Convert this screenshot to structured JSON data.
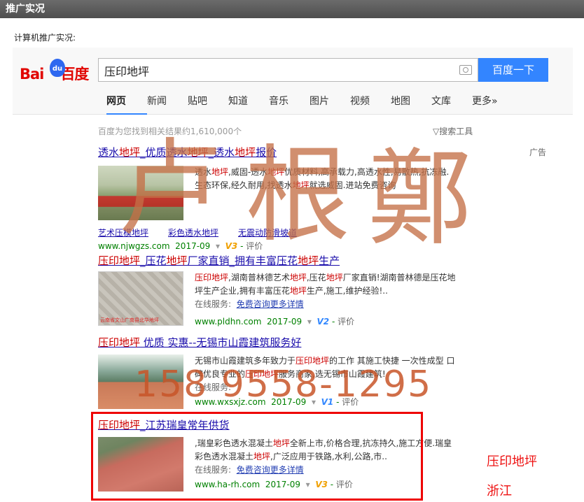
{
  "window": {
    "title": "推广实况",
    "subtitle": "计算机推广实况:"
  },
  "baidu": {
    "logo_text": "Bai",
    "logo_paw": "du",
    "logo_tail": "百度",
    "query": "压印地坪",
    "search_button": "百度一下",
    "tabs": [
      "网页",
      "新闻",
      "贴吧",
      "知道",
      "音乐",
      "图片",
      "视频",
      "地图",
      "文库",
      "更多»"
    ],
    "result_count": "百度为您找到相关结果约1,610,000个",
    "tools": "搜索工具",
    "ad_label": "广告"
  },
  "results": [
    {
      "title_parts": [
        "透水",
        "地坪",
        "_优质透水",
        "地坪",
        "_透水",
        "地坪",
        "报价"
      ],
      "desc_lines": [
        "透水地坪,威固-透水地坪优质材料,高承载力,高透水性,易散热,抗冻融.",
        "生态环保,经久耐用,找透水地坪就选威固.进站免费咨询"
      ],
      "sublinks": [
        "艺术压模地坪",
        "彩色透水地坪",
        "无震动防滑坡道"
      ],
      "url": "www.njwgzs.com",
      "date": "2017-09",
      "badge": "V3",
      "eval": "评价"
    },
    {
      "title_parts": [
        "压印地坪",
        "_压花",
        "地坪",
        "厂家直销_拥有丰富压花",
        "地坪",
        "生产"
      ],
      "desc_lines": [
        "压印地坪,湖南普林德艺术地坪,压花地坪厂家直销!湖南普林德是压花地",
        "坪生产企业,拥有丰富压花地坪生产,施工,维护经验!.."
      ],
      "service_label": "在线服务:",
      "service_link": "免费咨询更多详情",
      "url": "www.pldhn.com",
      "date": "2017-09",
      "badge": "V2",
      "eval": "评价"
    },
    {
      "title_parts": [
        "压印地坪",
        " 优质 实惠--无锡市山霞建筑服务好"
      ],
      "desc_lines": [
        "无锡市山霞建筑多年致力于压印地坪的工作 其施工快捷 一次性成型 口",
        "碑优良专业的压印地坪服务商家,选无锡市山霞建筑!"
      ],
      "service_label": "在线服务:",
      "url": "www.wxsxjz.com",
      "date": "2017-09",
      "badge": "V1",
      "eval": "评价"
    },
    {
      "title_parts": [
        "压印地坪",
        "_江苏瑞皇常年供货"
      ],
      "desc_lines": [
        ",瑞皇彩色透水混凝土地坪全新上市,价格合理,抗冻持久,施工方便.瑞皇",
        "彩色透水混凝土地坪,广泛应用于铁路,水利,公路,市.."
      ],
      "service_label": "在线服务:",
      "service_link": "免费咨询更多详情",
      "url": "www.ha-rh.com",
      "date": "2017-09",
      "badge": "V3",
      "eval": "评价"
    }
  ],
  "watermark": {
    "phone": "158 9558-1295",
    "seal_chars": [
      "卢",
      "根",
      "鄭"
    ]
  },
  "annotation": {
    "line1": "压印地坪",
    "line2": "浙江"
  },
  "thumb_captions": {
    "result2": "云南省文山广南县北华地坪"
  }
}
